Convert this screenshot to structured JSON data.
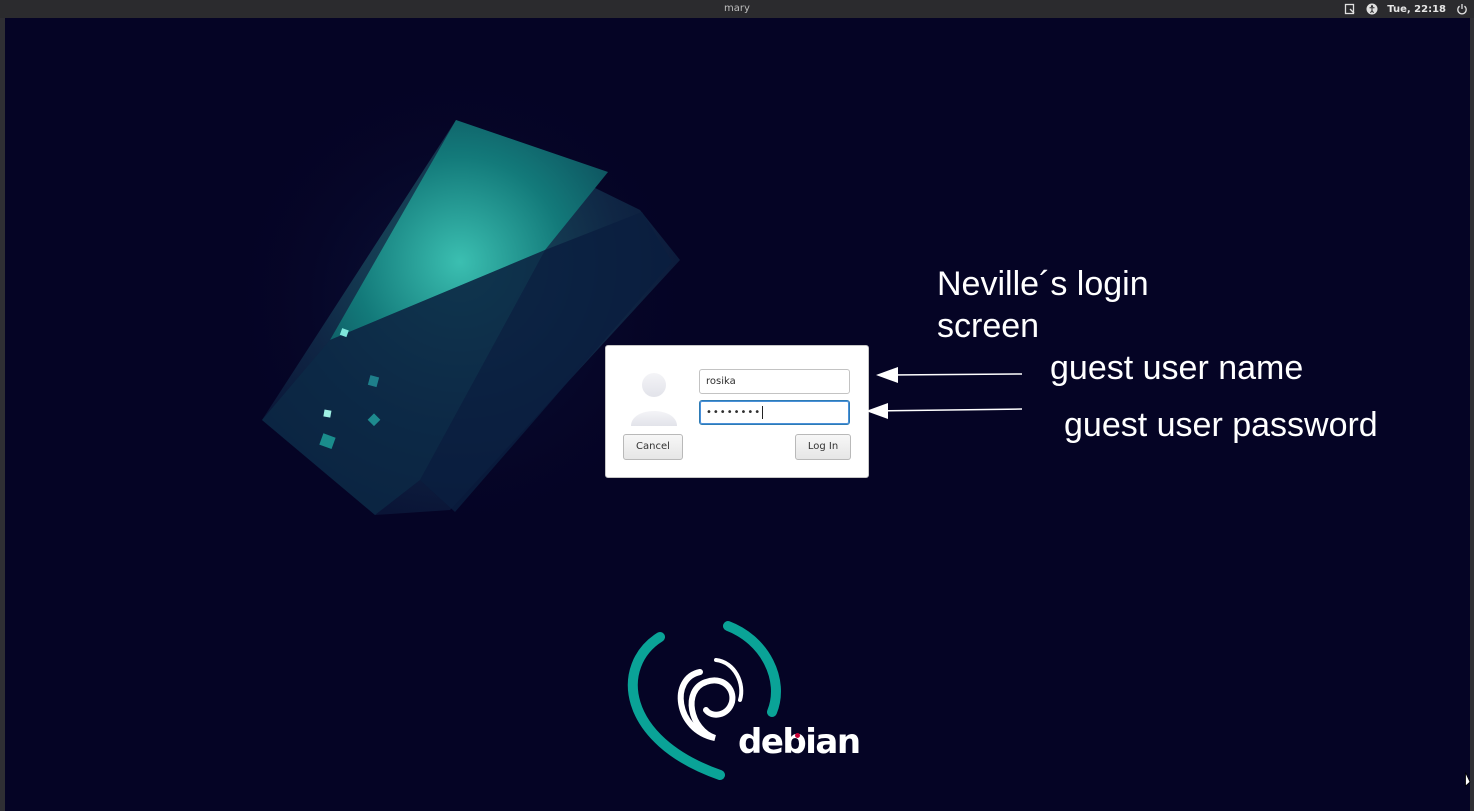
{
  "topbar": {
    "title": "mary",
    "clock": "Tue, 22:18",
    "indicators": [
      "accessibility-screen-reader-icon",
      "accessibility-icon",
      "power-icon"
    ]
  },
  "login_dialog": {
    "username_value": "rosika",
    "password_value": "••••••••",
    "cancel_label": "Cancel",
    "login_label": "Log In"
  },
  "annotations": {
    "title_line1": "Neville´s login",
    "title_line2": "screen",
    "username_note": "guest user name",
    "password_note": "guest user password"
  },
  "branding": {
    "logo_text": "debian",
    "logo_colors": [
      "#0aa397",
      "#ffffff",
      "#c70036"
    ]
  },
  "colors": {
    "background": "#050425",
    "accent_teal": "#2fb8ad",
    "topbar": "#2b2b2e"
  }
}
